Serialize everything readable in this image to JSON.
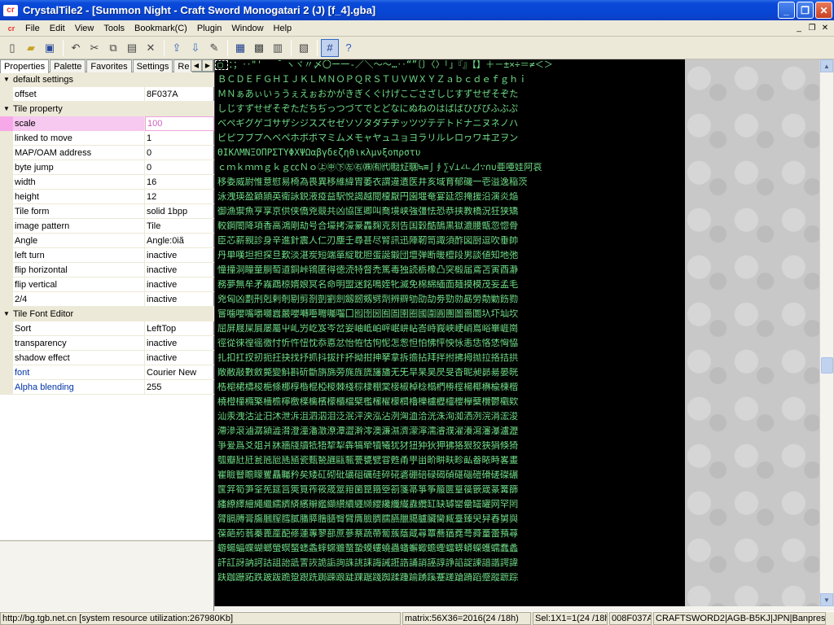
{
  "window": {
    "title": "CrystalTile2 - [Summon Night - Craft Sword Monogatari 2 (J) [f_4].gba]",
    "app_icon_text": "cr"
  },
  "menu": {
    "items": [
      "File",
      "Edit",
      "View",
      "Tools",
      "Bookmark(C)",
      "Plugin",
      "Window",
      "Help"
    ]
  },
  "toolbar": {
    "icons": [
      "new-file-icon",
      "open-folder-icon",
      "save-icon",
      "undo-icon",
      "cut-icon",
      "copy-icon",
      "paste-icon",
      "delete-icon",
      "export-icon",
      "import-icon",
      "edit-icon",
      "tile-view-icon",
      "palette-view-icon",
      "screenshot-icon",
      "import-image-icon",
      "grid-icon",
      "help-icon"
    ]
  },
  "tabs": [
    "Properties",
    "Palette",
    "Favorites",
    "Settings",
    "Re"
  ],
  "properties": {
    "categories": [
      {
        "name": "default settings",
        "rows": [
          {
            "name": "offset",
            "value": "8F037A"
          }
        ]
      },
      {
        "name": "Tile property",
        "rows": [
          {
            "name": "scale",
            "value": "100"
          },
          {
            "name": "linked to move",
            "value": "1"
          },
          {
            "name": "MAP/OAM address",
            "value": "0"
          },
          {
            "name": "byte jump",
            "value": "0"
          },
          {
            "name": "width",
            "value": "16"
          },
          {
            "name": "height",
            "value": "12"
          },
          {
            "name": "Tile form",
            "value": "solid 1bpp"
          },
          {
            "name": "image pattern",
            "value": "Tile"
          },
          {
            "name": "Angle",
            "value": "Angle:0iã"
          },
          {
            "name": "left turn",
            "value": "inactive"
          },
          {
            "name": "flip horizontal",
            "value": "inactive"
          },
          {
            "name": "flip vertical",
            "value": "inactive"
          },
          {
            "name": "2/4",
            "value": "inactive"
          }
        ]
      },
      {
        "name": "Tile Font Editor",
        "rows": [
          {
            "name": "Sort",
            "value": "LeftTop"
          },
          {
            "name": "transparency",
            "value": "inactive"
          },
          {
            "name": "shadow effect",
            "value": "inactive"
          },
          {
            "name": "font",
            "value": "Courier New"
          },
          {
            "name": "Alpha blending",
            "value": "255"
          }
        ]
      }
    ]
  },
  "tiles": {
    "rows": [
      "▢ ：；‥\"'｀ ̄＾ヽヾ〃〆〇ー一‐／＼～〜…‥“”〔〕〈〉「」『』【】＋－±×÷＝≠＜＞",
      "ＢＣＤＥＦＧＨＩＪＫＬＭＮＯＰＱＲＳＴＵＶＷＸＹＺａｂｃｄｅｆｇｈｉ",
      "ＭＮぁあぃいぅうぇえぉおかがきぎくぐけげこごさざしじすずせぜそぞた",
      "しじすずせぜそぞただちぢっつづてでとどなにぬねのはばぱひびぴふぶぷ",
      "べぺギグゲゴサザシジスズセゼソゾタダチヂッツヅテデトドナニヌネノハ",
      "ビピフブプヘベペホボポマミムメモャヤュユョヨラリルレロヮワヰヱヲン",
      "ΘΙΚΛΜΝΞΟΠΡΣΤΥΦΧΨΩαβγδεζηθικλμνξοπρστυ",
      "ｃｍｋｍｍｇｋｇ㏄Ｎｏ㊤㊥㊦㊧㊨㈱㈲㈹㍾㍽㍼≒≡∫∮∑√⊥∠∟⊿∵∩∪亜唖娃阿哀",
      "移委威尉惟意慰易椅為畏異移維緯胃萎衣謂違遺医井亥域育郁磯一壱溢逸稲茨",
      "泳洩瑛盈穎頴英衛詠鋭液疫益駅悦謁越閲榎厭円園堰奄宴延怨掩援沿演炎焔",
      "御漁禦魚亨享京供侠僑兇競共凶協匡卿叫喬境峡強彊怯恐恭挟教橋況狂狭矯",
      "較鋼閤降項香高鴻剛劫号合壕拷濠豪轟麹克刻告国穀酷鵠黒獄漉腰甑忽惚骨",
      "臣芯薪親診身辛進針震人仁刃塵壬尋甚尽腎訊迅陣靭笥諏須酢図厨逗吹垂帥",
      "丹単嘆坦担探旦歎淡湛炭短端箪綻耽胆蛋誕鍛団壇弾断暖檀段男談値知地弛",
      "憧撞洞瞳童胴萄道銅峠鴇匿得徳涜特督禿篤毒独読栃橡凸突椴届鳶苫寅酉瀞",
      "務夢無牟矛霧鵡椋婿娘冥名命明盟迷銘鳴姪牝滅免棉綿緬面麺摸模茂妄孟毛",
      "兇匈凶劃刑剋剌剞剔剪剳剴劉劍劔劒剱劈劑辨辧劬劭劼劵勁勍勗勞勣勦飭勠",
      "嘗噛嚶嘴嚼囃囂嚴嚶囀囈囎囑囓囗囮囹圀囿圄圉圈國圍圓團圖嗇圜圦圷圸坎",
      "屈屏屐屎屓屡屬屮乢屶屹岌岑岔妛岫岻岶岼岷峅岾峇峙峩峽峺峭嶌峪崋崕崗",
      "徑從徠徨徭徼忖忻忤忸忱忝悳忿怡恠怙怐怩怎怱怛怕怫怦怏怺恚恁恪恷恟恊",
      "扎扣扛扠扨扼抂抉找抒抓抖拔抃抔拗拑抻拏拿拆擔拈拜拌拊拂拇抛拉挌拮拱",
      "敞敝敲數斂斃變斛斟斫斷旃旆旁旄旌旒旛旙无旡旱杲昊昃旻杳昵昶昴昜晏晄",
      "梏梍桾檮梭梔條梛椁棔棍椏椶棘棧棕棣棚棠椄椒棹棯榻椚椦榁楊椰楙楡楝楷",
      "橈橙橦橢檠檣檐檸檄檪檎檳檬櫃檔檗檻櫁櫂檬櫚櫓櫟櫨櫪櫺櫻欅蘖欖鬱欟欸",
      "汕汞洩沽沚汨沐泄泝沮泗泅泪泛泯泙泱泓沾洌洶洫洽洸洙洵洳洒洌浣涓浤浚",
      "滯滲滾滷潺潁澁潸澄潼潘澂潦潭澀澣澪澳濂濕濟濛濘濡濬濮濯瀁瀉瀋瀑瀘瀝",
      "爭爰爲爻爼爿牀牆牋牘牴牾犂犁犇犒犖犢犧犹犲狃狆狄狎狒狢狠狡狹狷倏猗",
      "瓠瓣瓧瓩瓮瓲瓰瓱瓸瓷甄甃甅甌甎甍甕甓甞甦甬甼畄畍畊畉畛畆畚畩畤畧畫",
      "瞿瞼瞽瞻矇矍矗矚矜矣矮矼砌砒礦砠礪硅碎硴碆硼碚碌碣碵碪碯磑磆磋磔碾",
      "筺笄筍笋筌筅筵筥筴筧筰筱筬筮箝箘箟箍箜箚箋箒箏筝箙篋篁篌篏箴篆篝篩",
      "繙繚繹繪繩繼繻纃緕繽辮繿纈纉續纒纐纓纔纖纎纛纜缸缺罅罌罍罎罐网罕罔",
      "膂膈膊膏膓膕膣膤膩膰膵膾膸臀臂膺臉臍臑臙臘臈臚臟臠臧臺臻臾舁舂舅與",
      "葆葩葯蓊蓁蓖蓙蓜蓚蓮蓴蓼蔀蔗蔘蔡蔬蔕蔔蔟蔭蔵蕁蕈蕎蕕蕘蕚蕣蕫蕾蕷蕁",
      "蝣蝪蝠蝶蝴螂螢螟螯蟋螽蟀蟐雖螫蟄蟆螻蟯蟲蟠蠏蠍蟾蟶蟷蠎蟒蠑蠖蠕蠢蠡",
      "訐訌訝訥訶詁詛詒詆詈詼詭詬詢誅誂誄誨誡誑誥誦誚誣諄諍諂諚諫諳諧諤諱",
      "趺跏跚跖跌跛跋跪跫跟跣跼踈踉跿踝踞踐踟蹂踵踰踴蹊蹇蹉蹌蹐蹈蹙蹤蹠踪"
    ]
  },
  "statusbar": {
    "site": "http://bg.tgb.net.cn [system resource utilization:267980Kb]",
    "matrix": "matrix:56X36=2016(24 /18h)",
    "sel": "Sel:1X1=1(24 /18h)",
    "offset": "008F037A",
    "rom": "CRAFTSWORD2|AGB-B5KJ|JPN|Banpresto"
  }
}
